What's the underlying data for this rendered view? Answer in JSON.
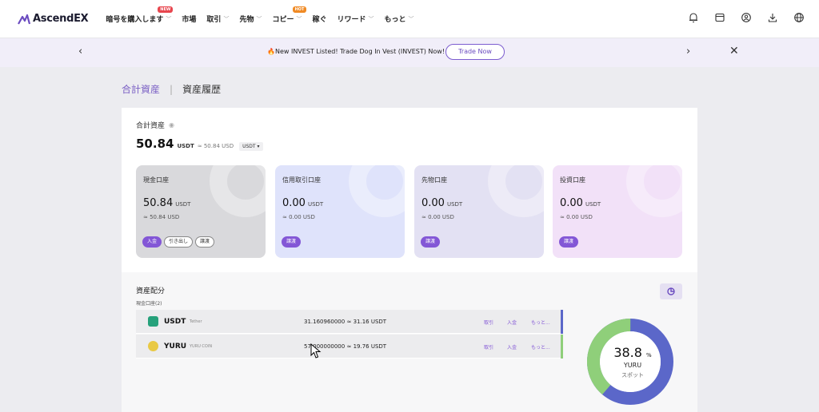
{
  "brand": {
    "name": "AscendEX",
    "accent": "#7a5fc4"
  },
  "nav": {
    "items": [
      {
        "label": "暗号を購入します",
        "badge": "NEW",
        "dropdown": true
      },
      {
        "label": "市場"
      },
      {
        "label": "取引",
        "dropdown": true
      },
      {
        "label": "先物",
        "dropdown": true
      },
      {
        "label": "コピー",
        "badge": "HOT",
        "dropdown": true
      },
      {
        "label": "稼ぐ"
      },
      {
        "label": "リワード",
        "dropdown": true
      },
      {
        "label": "もっと",
        "dropdown": true
      }
    ],
    "icons": [
      "bell-icon",
      "wallet-icon",
      "user-icon",
      "download-icon",
      "globe-icon"
    ]
  },
  "announcement": {
    "text": "🔥New INVEST Listed! Trade Dog In Vest (INVEST) Now!",
    "button": "Trade Now"
  },
  "breadcrumb": {
    "total": "合計資産",
    "sep": "|",
    "history": "資産履歴"
  },
  "total": {
    "label": "合計資産",
    "value": "50.84",
    "unit": "USDT",
    "usd": "≈ 50.84 USD",
    "currency": "USDT"
  },
  "accounts": [
    {
      "name": "現金口座",
      "value": "50.84",
      "unit": "USDT",
      "usd": "≈ 50.84 USD",
      "buttons": [
        "入金",
        "引き出し",
        "譲渡"
      ],
      "bg": "#d9d9dc"
    },
    {
      "name": "信用取引口座",
      "value": "0.00",
      "unit": "USDT",
      "usd": "≈ 0.00 USD",
      "buttons": [
        "譲渡"
      ],
      "bg": "#dfe3fb"
    },
    {
      "name": "先物口座",
      "value": "0.00",
      "unit": "USDT",
      "usd": "≈ 0.00 USD",
      "buttons": [
        "譲渡"
      ],
      "bg": "#e3e1f3"
    },
    {
      "name": "投資口座",
      "value": "0.00",
      "unit": "USDT",
      "usd": "≈ 0.00 USD",
      "buttons": [
        "譲渡"
      ],
      "bg": "#f2e1f8"
    }
  ],
  "allocation": {
    "title": "資産配分",
    "subtitle": "現金口座(2)",
    "rows": [
      {
        "symbol": "USDT",
        "name": "Tether",
        "amount": "31.160960000",
        "approx": "≈",
        "usd": "31.16 USDT",
        "trade": "取引",
        "deposit": "入金",
        "more": "もっと...",
        "color": "#5b67c9",
        "iconColor": "#26a17b"
      },
      {
        "symbol": "YURU",
        "name": "YURU COIN",
        "amount": "57.000000000",
        "approx": "≈",
        "usd": "19.76 USDT",
        "trade": "取引",
        "deposit": "入金",
        "more": "もっと...",
        "color": "#8fcf7a",
        "iconColor": "#e9c944"
      }
    ]
  },
  "donut": {
    "percent": "38.8",
    "percent_sign": "%",
    "symbol": "YURU",
    "type": "スポット",
    "share": 0.388,
    "colors": {
      "primary": "#5b67c9",
      "secondary": "#8fcf7a"
    }
  }
}
